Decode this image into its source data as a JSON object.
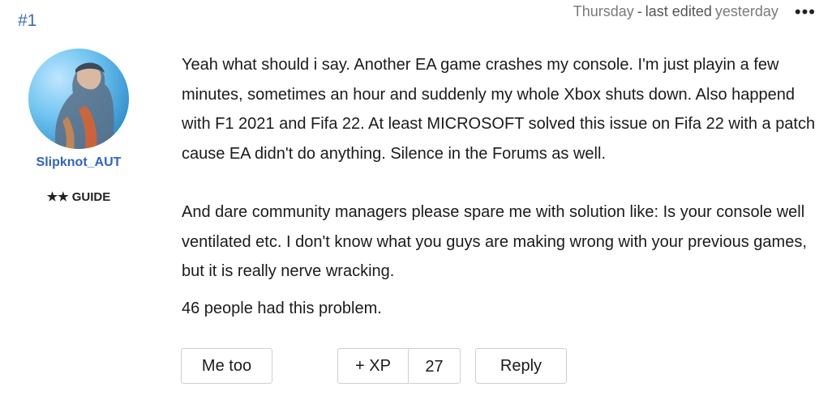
{
  "post": {
    "number": "#1",
    "date": "Thursday",
    "separator": "-",
    "edited_label": "last edited",
    "edited_when": "yesterday",
    "more_icon": "more-horizontal-icon"
  },
  "author": {
    "username": "Slipknot_AUT",
    "rank": "★★ GUIDE",
    "avatar_icon": "avatar-image"
  },
  "content": {
    "paragraph1": "Yeah what should i say. Another EA game crashes my console. I'm just playin a few minutes, sometimes an hour and suddenly my whole Xbox shuts down. Also happend with F1 2021 and Fifa 22. At least MICROSOFT solved this issue on Fifa 22 with a patch cause EA didn't do anything. Silence in the Forums as well.",
    "paragraph2": "And dare community managers please spare me with solution like: Is your console well ventilated etc. I don't know what you guys are making wrong with your previous games, but it is really nerve wracking.",
    "problem_count": "46 people had this problem."
  },
  "actions": {
    "me_too_label": "Me too",
    "xp_label": "+ XP",
    "xp_count": "27",
    "reply_label": "Reply"
  },
  "colors": {
    "accent": "#2f63c4",
    "post_number": "#3d6ab8",
    "meta_text": "#7a7a7a",
    "border": "#cfcfcf"
  }
}
